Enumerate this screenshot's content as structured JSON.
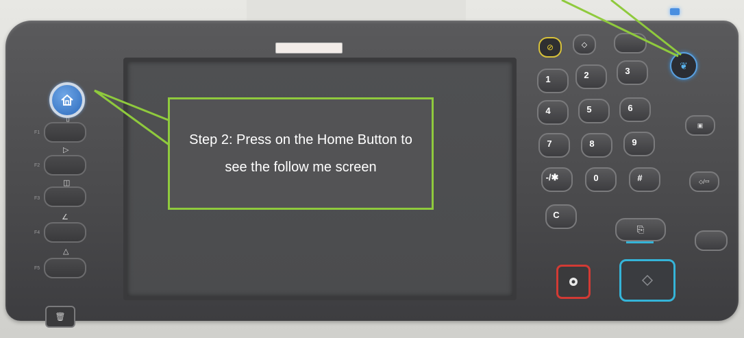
{
  "callout_left": {
    "text": "Step 2: Press on the Home Button to see the follow me screen"
  },
  "keypad": {
    "keys": [
      "1",
      "2",
      "3",
      "4",
      "5",
      "6",
      "7",
      "8",
      "9",
      "-/✱",
      "0",
      "#",
      "C"
    ]
  },
  "left_buttons": {
    "tags": [
      "F1",
      "F2",
      "F3",
      "F4",
      "F5"
    ]
  },
  "colors": {
    "callout_border": "#8fca3d",
    "home_button": "#2c6bbd",
    "stop_button": "#d23a34",
    "start_button": "#35b4d8",
    "eco_button": "#59b3ee"
  },
  "icons": {
    "home": "home-icon",
    "eco": "leaf-icon",
    "stop": "stop-icon",
    "start": "start-icon"
  }
}
